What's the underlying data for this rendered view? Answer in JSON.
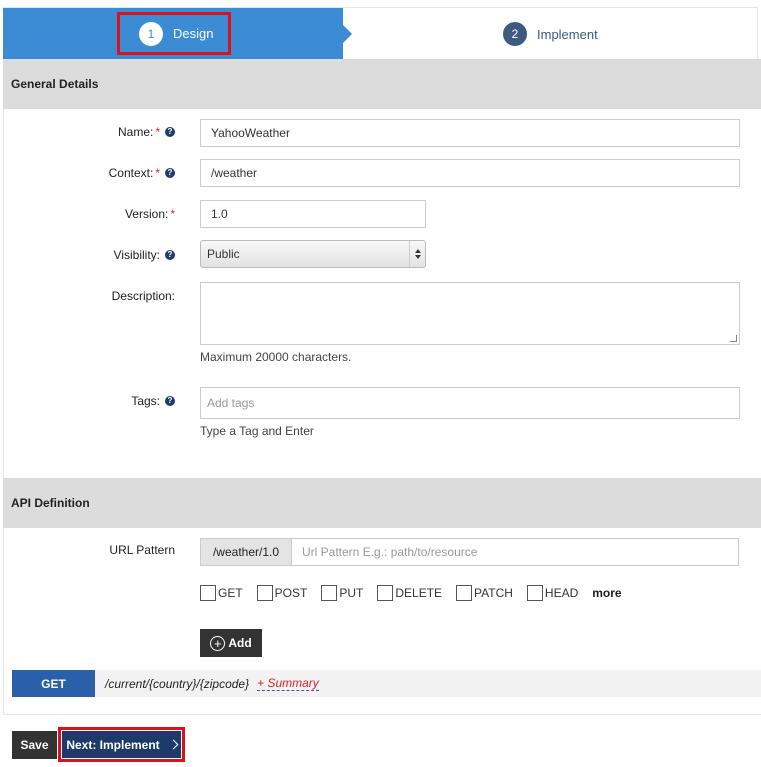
{
  "wizard": {
    "steps": [
      {
        "number": "1",
        "label": "Design"
      },
      {
        "number": "2",
        "label": "Implement"
      }
    ]
  },
  "general": {
    "title": "General Details",
    "name": {
      "label": "Name:",
      "required": "*",
      "value": "YahooWeather"
    },
    "context": {
      "label": "Context:",
      "required": "*",
      "value": "/weather"
    },
    "version": {
      "label": "Version:",
      "required": "*",
      "value": "1.0"
    },
    "visibility": {
      "label": "Visibility:",
      "value": "Public"
    },
    "description": {
      "label": "Description:",
      "hint": "Maximum 20000 characters."
    },
    "tags": {
      "label": "Tags:",
      "placeholder": "Add tags",
      "hint": "Type a Tag and Enter"
    },
    "help_glyph": "?"
  },
  "api": {
    "title": "API Definition",
    "url_pattern": {
      "label": "URL Pattern",
      "prefix": "/weather/1.0",
      "placeholder": "Url Pattern E.g.: path/to/resource"
    },
    "methods": [
      "GET",
      "POST",
      "PUT",
      "DELETE",
      "PATCH",
      "HEAD"
    ],
    "more": "more",
    "add_label": "Add",
    "add_glyph": "+",
    "resource": {
      "method": "GET",
      "path": "/current/{country}/{zipcode}",
      "summary": "+ Summary"
    }
  },
  "actions": {
    "save": "Save",
    "next": "Next: Implement"
  },
  "colors": {
    "accent": "#3b8bd5",
    "highlight": "#e0101a",
    "primary_dark": "#1e3a6b"
  }
}
